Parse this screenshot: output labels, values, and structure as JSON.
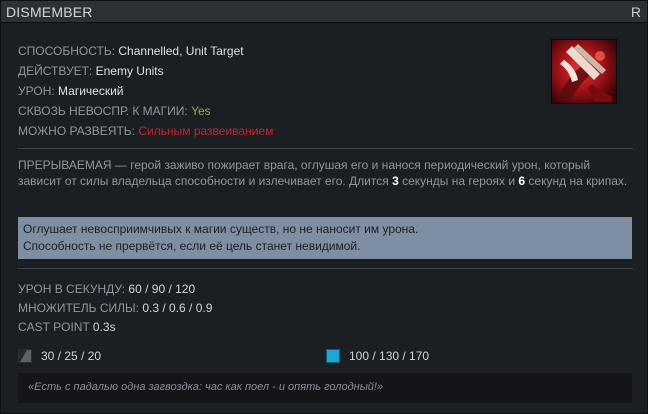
{
  "header": {
    "title": "DISMEMBER",
    "hotkey": "R"
  },
  "stats": [
    {
      "label": "СПОСОБНОСТЬ:",
      "value": "Channelled, Unit Target",
      "kind": "normal"
    },
    {
      "label": "ДЕЙСТВУЕТ:",
      "value": "Enemy Units",
      "kind": "normal"
    },
    {
      "label": "УРОН:",
      "value": "Магический",
      "kind": "normal"
    },
    {
      "label": "СКВОЗЬ НЕВОСПР. К МАГИИ:",
      "value": "Yes",
      "kind": "yes"
    },
    {
      "label": "МОЖНО РАЗВЕЯТЬ:",
      "value": "Сильным развеиванием",
      "kind": "red"
    }
  ],
  "portrait": {
    "icon": "dismember-ability-icon"
  },
  "description": {
    "part1": "ПРЕРЫВАЕМАЯ — герой заживо пожирает врага, оглушая его и нанося периодический урон, который зависит от силы владельца способности и излечивает его. Длится ",
    "hero_duration": "3",
    "part2": " секунды на героях и ",
    "creep_duration": "6",
    "part3": " секунд на крипах."
  },
  "notes": [
    "Оглушает невосприимчивых к магии существ, но не наносит им урона.",
    "Способность не прервётся, если её цель станет невидимой."
  ],
  "specials": [
    {
      "label": "УРОН В СЕКУНДУ:",
      "value": "60 / 90 / 120"
    },
    {
      "label": "МНОЖИТЕЛЬ СИЛЫ:",
      "value": "0.3 / 0.6 / 0.9"
    },
    {
      "label": "CAST POINT",
      "value": "0.3s"
    }
  ],
  "costs": {
    "cooldown": {
      "icon": "cooldown-icon",
      "value": "30 / 25 / 20"
    },
    "mana": {
      "icon": "mana-icon",
      "value": "100 / 130 / 170"
    }
  },
  "lore": "«Есть с падалью одна загвоздка: час как поел - и опять голодный!»",
  "colors": {
    "background": "#1b1e23",
    "label": "#8f979f",
    "value": "#dde1e4",
    "yes": "#91b24a",
    "dispel_red": "#c42626",
    "notes_bg": "#7e8fa3",
    "mana": "#1ea7d6"
  }
}
